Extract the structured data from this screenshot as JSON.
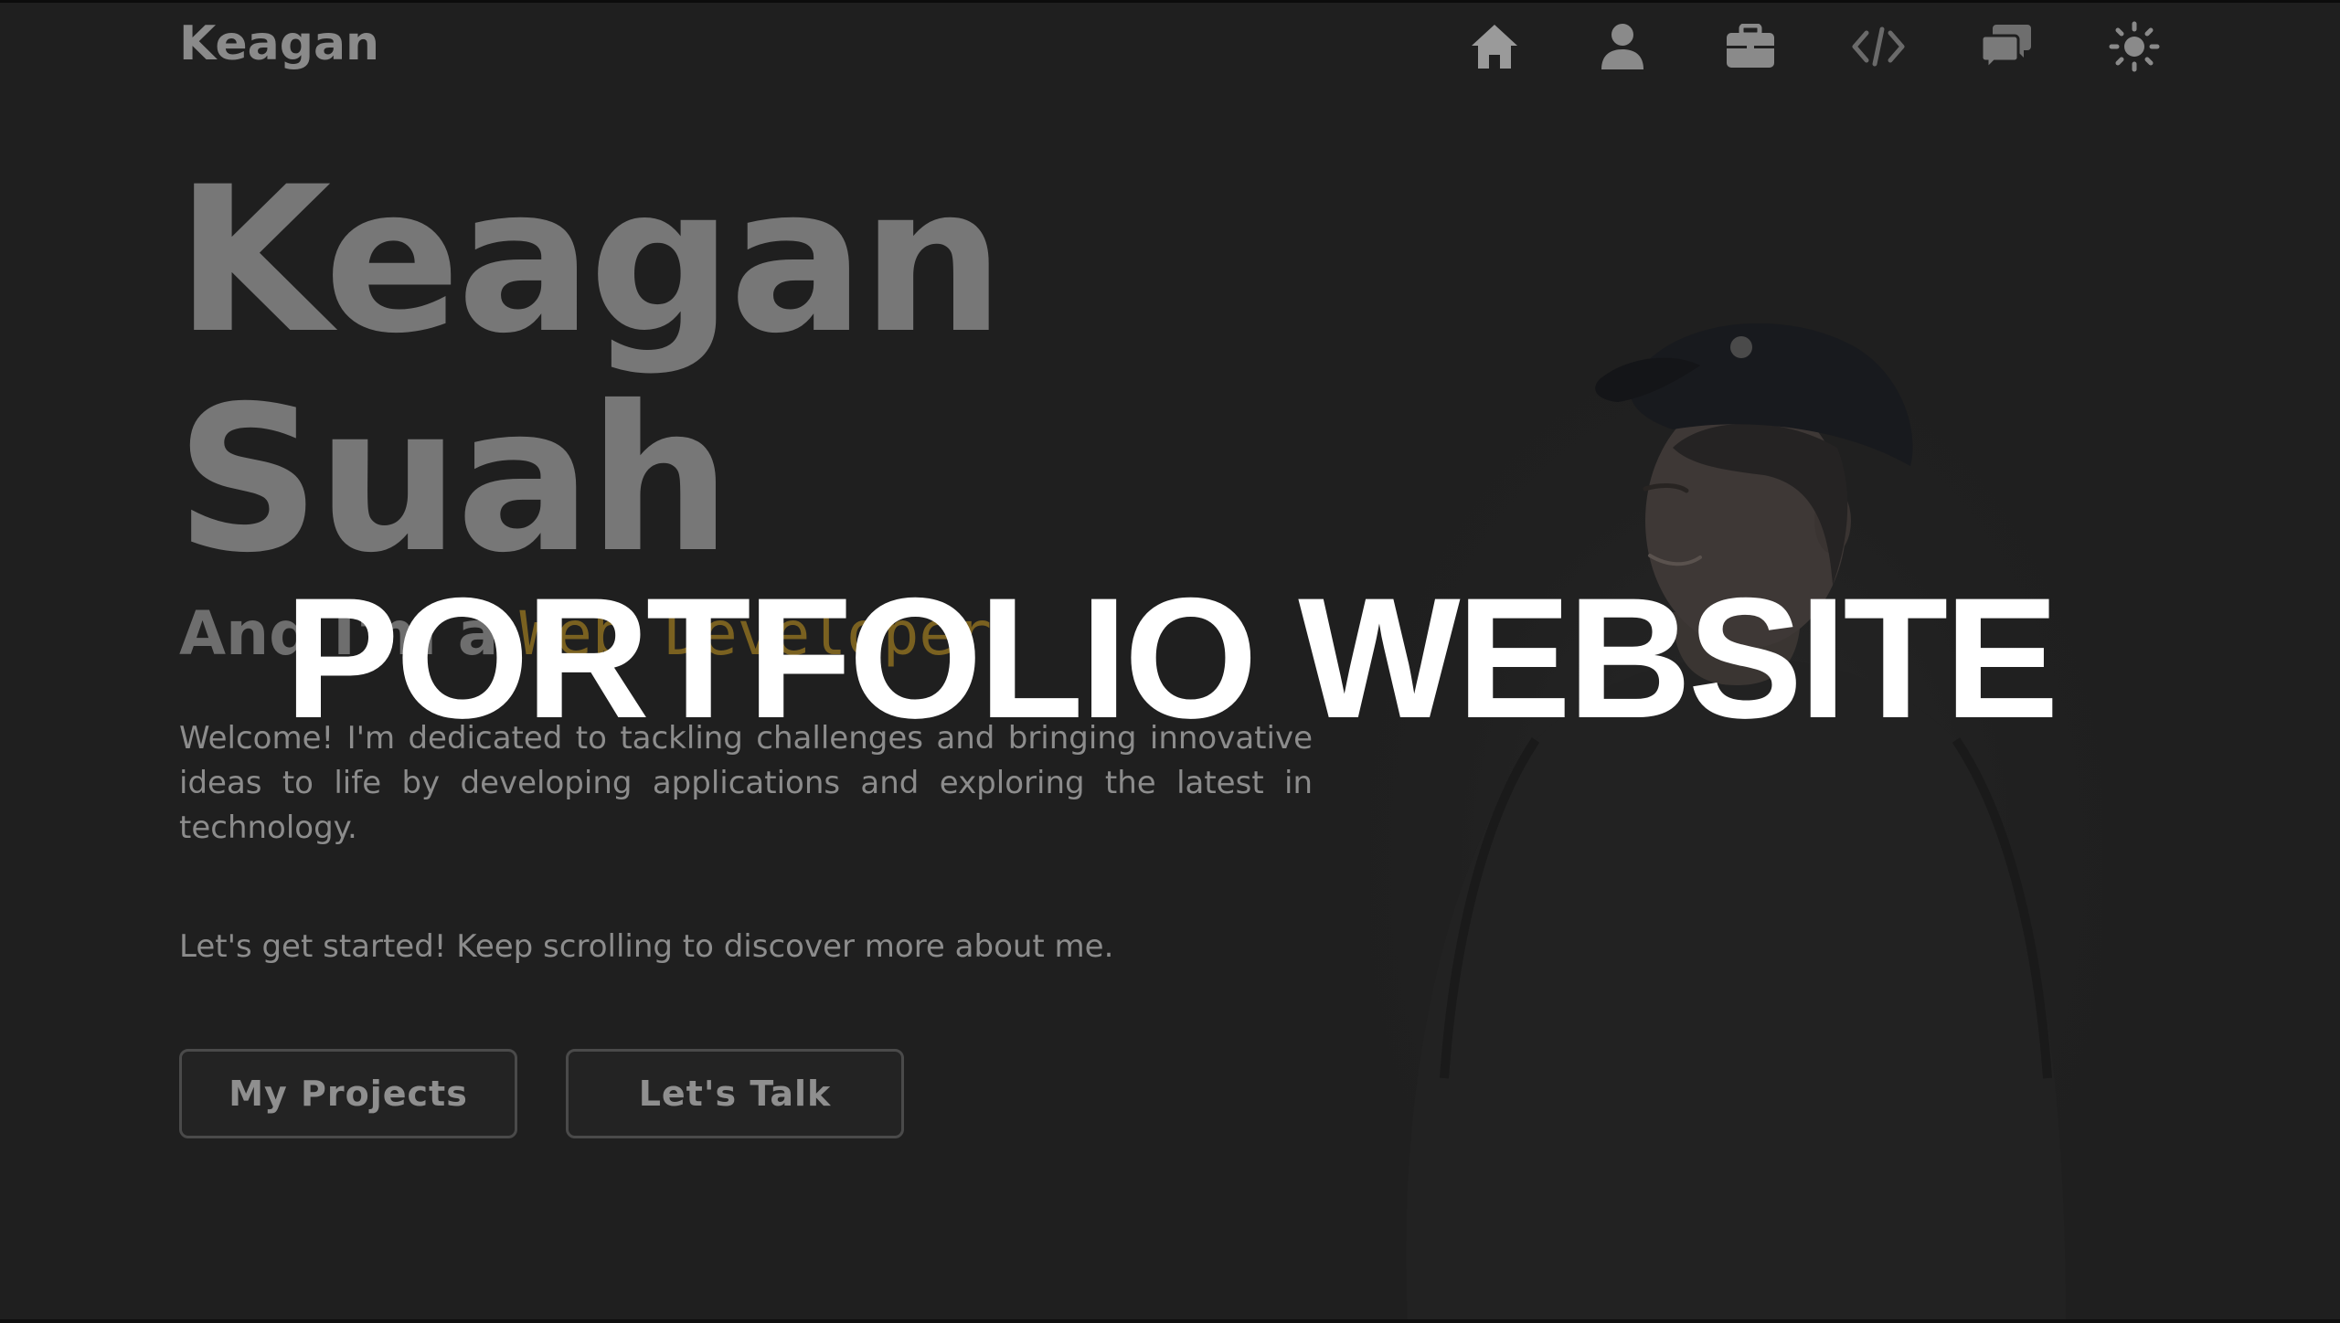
{
  "header": {
    "brand": "Keagan"
  },
  "nav": {
    "items": [
      {
        "name": "home-icon"
      },
      {
        "name": "user-icon"
      },
      {
        "name": "briefcase-icon"
      },
      {
        "name": "code-icon"
      },
      {
        "name": "chat-icon"
      },
      {
        "name": "sun-icon"
      }
    ]
  },
  "hero": {
    "name_line1": "Keagan",
    "name_line2": "Suah",
    "role_prefix": "And I'm a",
    "role_typed": "Web Developer",
    "caret": "|",
    "intro": "Welcome! I'm dedicated to tackling challenges and bringing innovative ideas to life by developing applications and exploring the latest in technology.",
    "cta": "Let's get started! Keep scrolling to discover more about me."
  },
  "buttons": {
    "projects_label": "My Projects",
    "talk_label": "Let's Talk"
  },
  "overlay": {
    "title": "PORTFOLIO WEBSITE"
  },
  "colors": {
    "background": "#1f1f1f",
    "text_muted": "#8c8c8c",
    "accent_typed": "#7a6120",
    "overlay_text": "#ffffff"
  }
}
